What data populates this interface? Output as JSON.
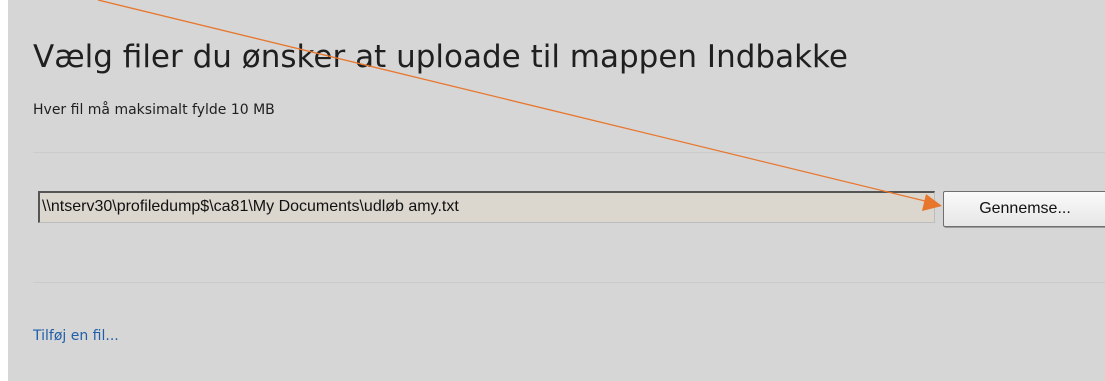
{
  "dialog": {
    "title": "Vælg filer du ønsker at uploade til mappen Indbakke",
    "size_limit_text": "Hver fil må maksimalt fylde 10 MB",
    "file_input": {
      "value": "\\\\ntserv30\\profiledump$\\ca81\\My Documents\\udløb amy.txt"
    },
    "browse_button_label": "Gennemse...",
    "add_file_link": "Tilføj en fil..."
  },
  "colors": {
    "panel_background": "#d6d6d6",
    "link": "#1f5fa8",
    "annotation_arrow": "#e8772e"
  },
  "icons": {
    "annotation": "arrow-annotation-icon"
  }
}
